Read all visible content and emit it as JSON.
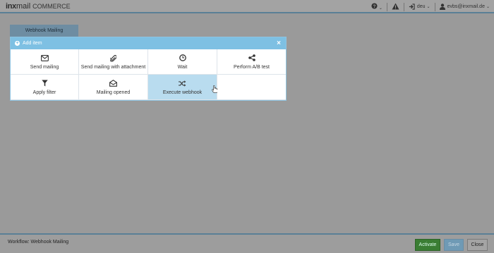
{
  "header": {
    "logo_inx": "inx",
    "logo_mail": "mail",
    "logo_commerce": "COMMERCE",
    "language": "deu",
    "user": "evbs@inxmail.de"
  },
  "workflow_tab": {
    "label": "Webhook Mailing"
  },
  "add_item_panel": {
    "title": "Add item",
    "items": [
      {
        "label": "Send mailing",
        "icon": "envelope-icon"
      },
      {
        "label": "Send mailing with attachment",
        "icon": "paperclip-icon"
      },
      {
        "label": "Wait",
        "icon": "clock-icon"
      },
      {
        "label": "Perform A/B test",
        "icon": "share-icon"
      },
      {
        "label": "Apply filter",
        "icon": "filter-icon"
      },
      {
        "label": "Mailing opened",
        "icon": "envelope-open-icon"
      },
      {
        "label": "Execute webhook",
        "icon": "shuffle-icon"
      }
    ]
  },
  "footer": {
    "title": "Workflow: Webhook Mailing",
    "activate_label": "Activate",
    "save_label": "Save",
    "close_label": "Close"
  },
  "colors": {
    "panel_header": "#7ec0e3",
    "hover_cell": "#b9dcef",
    "activate": "#3a7d33",
    "save": "#6f9ab5"
  }
}
